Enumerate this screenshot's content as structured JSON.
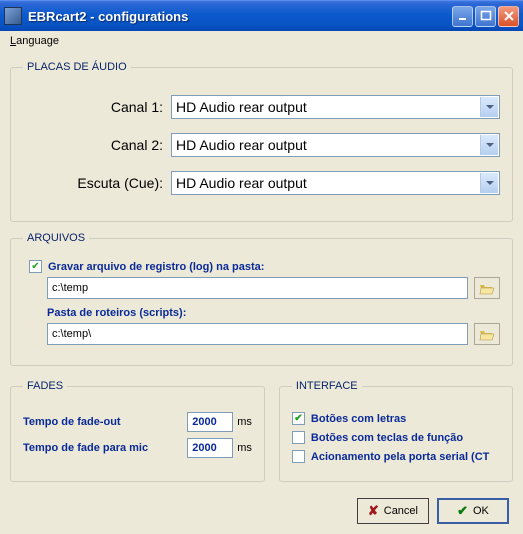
{
  "titlebar": {
    "title": "EBRcart2 - configurations"
  },
  "menubar": {
    "language": "Language"
  },
  "audio": {
    "legend": "PLACAS DE ÁUDIO",
    "ch1_label": "Canal 1:",
    "ch2_label": "Canal 2:",
    "cue_label": "Escuta (Cue):",
    "ch1_value": "HD Audio rear output",
    "ch2_value": "HD Audio rear output",
    "cue_value": "HD Audio rear output"
  },
  "arquivos": {
    "legend": "ARQUIVOS",
    "log_label": "Gravar arquivo de registro (log) na pasta:",
    "log_path": "c:\\temp",
    "scripts_label": "Pasta de roteiros (scripts):",
    "scripts_path": "c:\\temp\\"
  },
  "fades": {
    "legend": "FADES",
    "out_label": "Tempo de fade-out",
    "out_value": "2000",
    "mic_label": "Tempo de fade para mic",
    "mic_value": "2000",
    "unit": "ms"
  },
  "iface": {
    "legend": "INTERFACE",
    "letters": "Botões com letras",
    "fkeys": "Botões com teclas de função",
    "serial": "Acionamento pela porta serial (CT"
  },
  "buttons": {
    "cancel": "Cancel",
    "ok": "OK"
  }
}
